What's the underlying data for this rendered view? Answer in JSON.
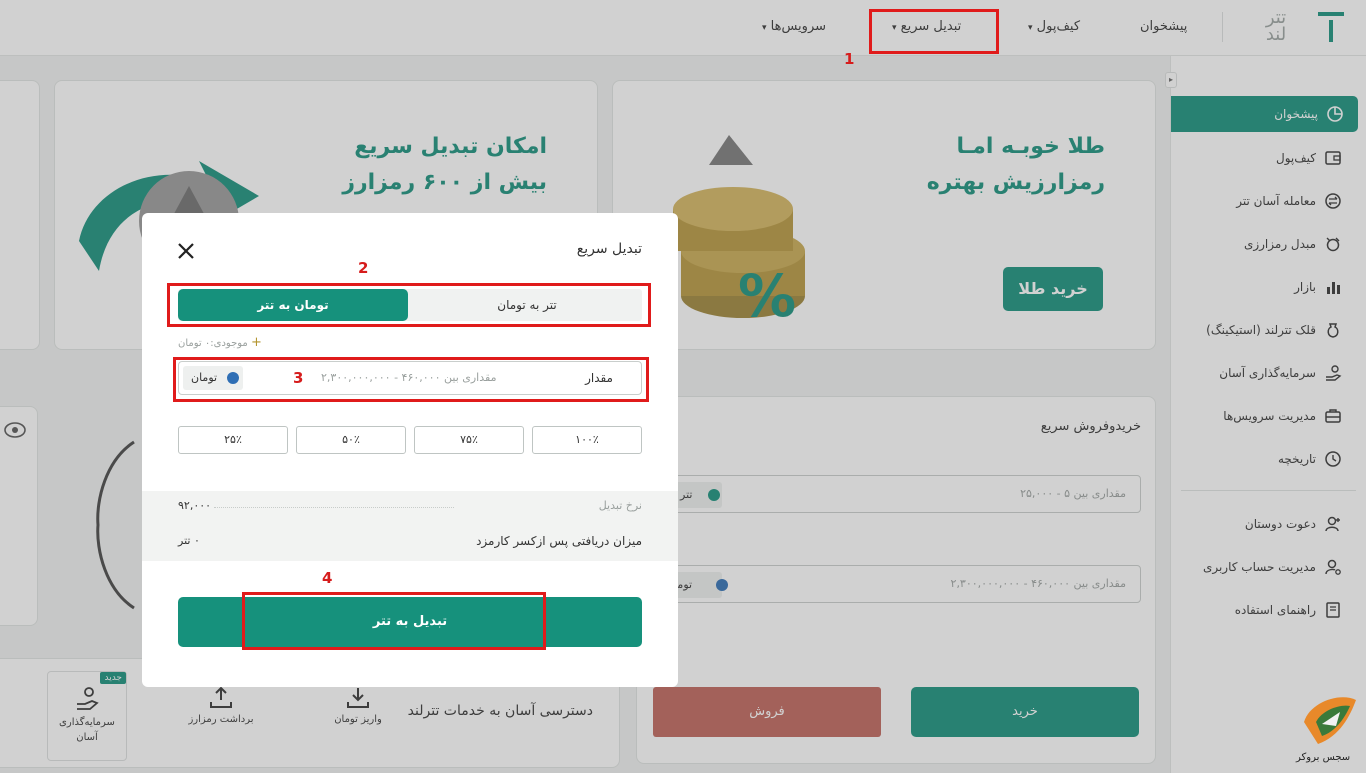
{
  "topbar": {
    "logo_line1": "تتر",
    "logo_line2": "لند",
    "nav": [
      "پیشخوان",
      "کیف‌پول",
      "تبدیل سریع",
      "سرویس‌ها"
    ]
  },
  "sidebar": {
    "items": [
      "پیشخوان",
      "کیف‌پول",
      "معامله آسان تتر",
      "مبدل رمزارزی",
      "بازار",
      "قلک تترلند (استیکینگ)",
      "سرمایه‌گذاری آسان",
      "مدیریت سرویس‌ها",
      "تاریخچه"
    ],
    "items2": [
      "دعوت دوستان",
      "مدیریت حساب کاربری",
      "راهنمای استفاده"
    ],
    "active_index": 0
  },
  "banners": {
    "gold_title_1": "طلا خوبـه امـا",
    "gold_title_2": "رمزارزیش بهتره",
    "gold_button": "خرید طلا",
    "swap_title_1": "امکان تبدیل سریع",
    "swap_title_2": "بیش از ۶۰۰ رمزارز"
  },
  "quick_trade": {
    "title": "خریدوفروش سریع",
    "tether_placeholder": "مقداری بین ۵ - ۲۵,۰۰۰",
    "tether_unit": "تتر",
    "toman_placeholder": "مقداری بین ۴۶۰,۰۰۰ - ۲,۳۰۰,۰۰۰,۰۰۰",
    "toman_unit": "تومان",
    "buy": "خرید",
    "sell": "فروش"
  },
  "services": {
    "title": "دسترسی آسان به خدمات تترلند",
    "items": [
      "واریز تومان",
      "برداشت رمزارز",
      "سرمایه‌گذاری آسان"
    ],
    "new_badge": "جدید"
  },
  "modal": {
    "title": "تبدیل سریع",
    "tab_left": "تومان به تتر",
    "tab_right": "تتر به تومان",
    "balance": "موجودی:۰ تومان",
    "amount_label": "مقدار",
    "amount_placeholder": "مقداری بین ۴۶۰,۰۰۰ - ۲,۳۰۰,۰۰۰,۰۰۰",
    "amount_unit": "تومان",
    "percents": [
      "۱۰۰٪",
      "۷۵٪",
      "۵۰٪",
      "۲۵٪"
    ],
    "rate_label": "نرخ تبدیل",
    "rate_value": "۹۲,۰۰۰",
    "receive_label": "میزان دریافتی پس ازکسر کارمزد",
    "receive_value": "۰ تتر",
    "submit": "تبدیل به تتر"
  },
  "annotations": [
    "1",
    "2",
    "3",
    "4"
  ],
  "watermark": "سجس بروکر",
  "colors": {
    "accent": "#16917c",
    "sell": "#c0645a",
    "highlight": "#e01b1b"
  }
}
